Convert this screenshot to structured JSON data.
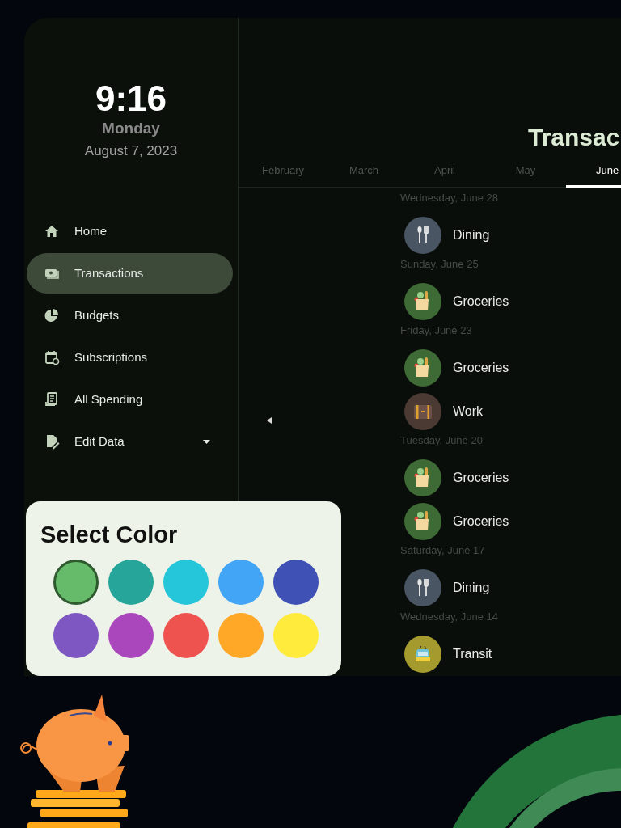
{
  "sidebar": {
    "time": "9:16",
    "day": "Monday",
    "date": "August 7, 2023",
    "nav_items": [
      {
        "label": "Home",
        "selected": false
      },
      {
        "label": "Transactions",
        "selected": true
      },
      {
        "label": "Budgets",
        "selected": false
      },
      {
        "label": "Subscriptions",
        "selected": false
      },
      {
        "label": "All Spending",
        "selected": false
      },
      {
        "label": "Edit Data",
        "selected": false,
        "has_dropdown": true
      }
    ]
  },
  "main": {
    "title": "Transac",
    "tabs": [
      {
        "label": "February",
        "selected": false
      },
      {
        "label": "March",
        "selected": false
      },
      {
        "label": "April",
        "selected": false
      },
      {
        "label": "May",
        "selected": false
      },
      {
        "label": "June",
        "selected": true
      }
    ],
    "days": [
      {
        "date": "Wednesday, June 28",
        "transactions": [
          {
            "category": "Dining",
            "kind": "dining",
            "color": "#4a5563"
          }
        ]
      },
      {
        "date": "Sunday, June 25",
        "transactions": [
          {
            "category": "Groceries",
            "kind": "groceries",
            "color": "#3e6b35"
          }
        ]
      },
      {
        "date": "Friday, June 23",
        "transactions": [
          {
            "category": "Groceries",
            "kind": "groceries",
            "color": "#3e6b35"
          },
          {
            "category": "Work",
            "kind": "work",
            "color": "#4a3a33"
          }
        ]
      },
      {
        "date": "Tuesday, June 20",
        "transactions": [
          {
            "category": "Groceries",
            "kind": "groceries",
            "color": "#3e6b35"
          },
          {
            "category": "Groceries",
            "kind": "groceries",
            "color": "#3e6b35"
          }
        ]
      },
      {
        "date": "Saturday, June 17",
        "transactions": [
          {
            "category": "Dining",
            "kind": "dining",
            "color": "#4a5563"
          }
        ]
      },
      {
        "date": "Wednesday, June 14",
        "transactions": [
          {
            "category": "Transit",
            "kind": "transit",
            "color": "#a49a2e"
          }
        ]
      }
    ]
  },
  "color_picker": {
    "title": "Select Color",
    "swatches": [
      {
        "color": "#66bb6a",
        "selected": true
      },
      {
        "color": "#26a69a",
        "selected": false
      },
      {
        "color": "#26c6da",
        "selected": false
      },
      {
        "color": "#42a5f5",
        "selected": false
      },
      {
        "color": "#3f51b5",
        "selected": false
      },
      {
        "color": "#7e57c2",
        "selected": false
      },
      {
        "color": "#ab47bc",
        "selected": false
      },
      {
        "color": "#ef5350",
        "selected": false
      },
      {
        "color": "#ffa726",
        "selected": false
      },
      {
        "color": "#ffeb3b",
        "selected": false
      }
    ]
  }
}
